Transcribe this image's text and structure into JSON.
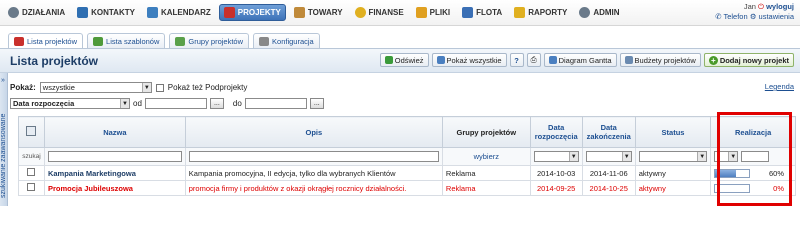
{
  "nav": [
    {
      "label": "DZIAŁANIA",
      "icon": "gear-icon",
      "color": "#6a7a8a"
    },
    {
      "label": "KONTAKTY",
      "icon": "contacts-icon",
      "color": "#2f6fb2"
    },
    {
      "label": "KALENDARZ",
      "icon": "calendar-icon",
      "color": "#3d7fbf"
    },
    {
      "label": "PROJEKTY",
      "icon": "projects-icon",
      "color": "#c9302c"
    },
    {
      "label": "TOWARY",
      "icon": "box-icon",
      "color": "#c08a3a"
    },
    {
      "label": "FINANSE",
      "icon": "coins-icon",
      "color": "#e0b020"
    },
    {
      "label": "PLIKI",
      "icon": "folder-icon",
      "color": "#e0a020"
    },
    {
      "label": "FLOTA",
      "icon": "car-icon",
      "color": "#3a6fb5"
    },
    {
      "label": "RAPORTY",
      "icon": "report-icon",
      "color": "#e0b020"
    },
    {
      "label": "ADMIN",
      "icon": "admin-icon",
      "color": "#6a7a8a"
    }
  ],
  "user": {
    "name": "Jan",
    "logout": "wyloguj",
    "phone": "Telefon",
    "settings": "ustawienia"
  },
  "tabs": [
    {
      "label": "Lista projektów"
    },
    {
      "label": "Lista szablonów"
    },
    {
      "label": "Grupy projektów"
    },
    {
      "label": "Konfiguracja"
    }
  ],
  "page": {
    "title": "Lista projektów"
  },
  "actions": {
    "refresh": "Odśwież",
    "show_all": "Pokaż wszystkie",
    "gantt": "Diagram Gantta",
    "budgets": "Budżety projektów",
    "add": "Dodaj nowy projekt"
  },
  "sidebar": {
    "label": "szukiwanie zaawansowane"
  },
  "filters": {
    "show_label": "Pokaż:",
    "show_value": "wszystkie",
    "subprojects": "Pokaż też Podprojekty",
    "date_field": "Data rozpoczęcia",
    "from": "od",
    "to": "do",
    "dots": "...",
    "legend": "Legenda"
  },
  "table": {
    "headers": [
      "Nazwa",
      "Opis",
      "Grupy projektów",
      "Data rozpoczęcia",
      "Data zakończenia",
      "Status",
      "Realizacja"
    ],
    "search_label": "szukaj",
    "group_filter": "wybierz",
    "rows": [
      {
        "name": "Kampania Marketingowa",
        "desc": "Kampania promocyjna, II edycja, tylko dla wybranych Klientów",
        "group": "Reklama",
        "start": "2014-10-03",
        "end": "2014-11-06",
        "status": "aktywny",
        "progress": 60,
        "progress_label": "60%"
      },
      {
        "name": "Promocja Jubileuszowa",
        "desc": "promocja firmy i produktów z okazji okrągłej rocznicy działalności.",
        "group": "Reklama",
        "start": "2014-09-25",
        "end": "2014-10-25",
        "status": "aktywny",
        "progress": 0,
        "progress_label": "0%"
      }
    ]
  }
}
